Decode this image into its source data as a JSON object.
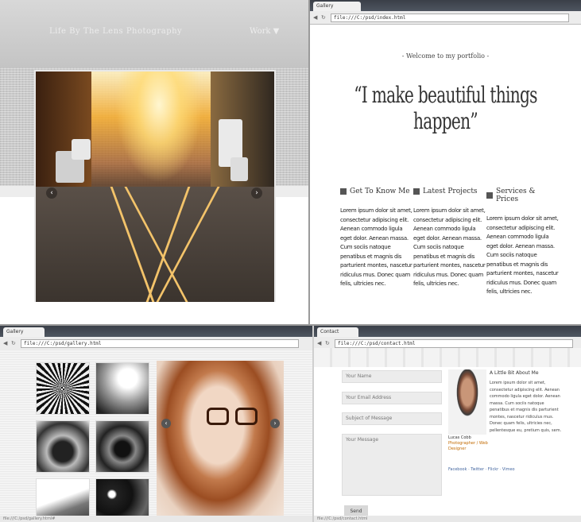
{
  "q1": {
    "site_title": "Life By The Lens Photography",
    "nav": "Work ▼",
    "slider_prev": "‹",
    "slider_next": "›"
  },
  "q2": {
    "tab_label": "Gallery",
    "url": "file:///C:/psd/index.html",
    "pretitle": "- Welcome to my portfolio -",
    "headline": "“I make beautiful things happen”",
    "columns": [
      {
        "title": "Get To Know Me",
        "text": "Lorem ipsum dolor sit amet, consectetur adipiscing elit. Aenean commodo ligula eget dolor. Aenean massa. Cum sociis natoque penatibus et magnis dis parturient montes, nascetur ridiculus mus. Donec quam felis, ultricies nec."
      },
      {
        "title": "Latest Projects",
        "text": "Lorem ipsum dolor sit amet, consectetur adipiscing elit. Aenean commodo ligula eget dolor. Aenean massa. Cum sociis natoque penatibus et magnis dis parturient montes, nascetur ridiculus mus. Donec quam felis, ultricies nec."
      },
      {
        "title": "Services & Prices",
        "text": "Lorem ipsum dolor sit amet, consectetur adipiscing elit. Aenean commodo ligula eget dolor. Aenean massa. Cum sociis natoque penatibus et magnis dis parturient montes, nascetur ridiculus mus. Donec quam felis, ultricies nec."
      }
    ]
  },
  "q3": {
    "tab_label": "Gallery",
    "url": "file:///C:/psd/gallery.html",
    "prev": "‹",
    "next": "›",
    "status": "file:///C:/psd/gallery.html#"
  },
  "q4": {
    "tab_label": "Contact",
    "url": "file:///C:/psd/contact.html",
    "fields": [
      "Your Name",
      "Your Email Address",
      "Subject of Message"
    ],
    "message_placeholder": "Your Message",
    "send_label": "Send",
    "bio_title": "A Little Bit About Me",
    "bio_text": "Lorem ipsum dolor sit amet, consectetur adipiscing elit. Aenean commodo ligula eget dolor. Aenean massa. Cum sociis natoque penatibus et magnis dis parturient montes, nascetur ridiculus mus. Donec quam felis, ultricies nec, pellentesque eu, pretium quis, sem.",
    "caption_name": "Lucas Cobb",
    "caption_role": "Photographer / Web Designer",
    "social": "Facebook · Twitter · Flickr · Vimeo",
    "status": "file:///C:/psd/contact.html"
  }
}
